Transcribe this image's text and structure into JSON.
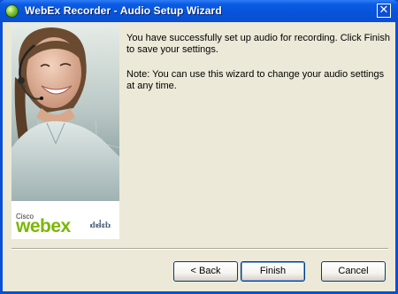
{
  "window": {
    "title": "WebEx Recorder - Audio Setup Wizard",
    "close_glyph": "✕"
  },
  "banner": {
    "brand_small": "Cisco",
    "brand_large": "webex",
    "cisco_label": "CISCO",
    "brand_color": "#7ab800"
  },
  "message": {
    "line1": "You have successfully set up audio for recording. Click Finish to save your settings.",
    "line2": "Note: You can use this wizard to change your audio settings at any time."
  },
  "buttons": {
    "back": "< Back",
    "finish": "Finish",
    "cancel": "Cancel"
  },
  "colors": {
    "titlebar": "#0653d8",
    "dialog_bg": "#ece9d8"
  }
}
